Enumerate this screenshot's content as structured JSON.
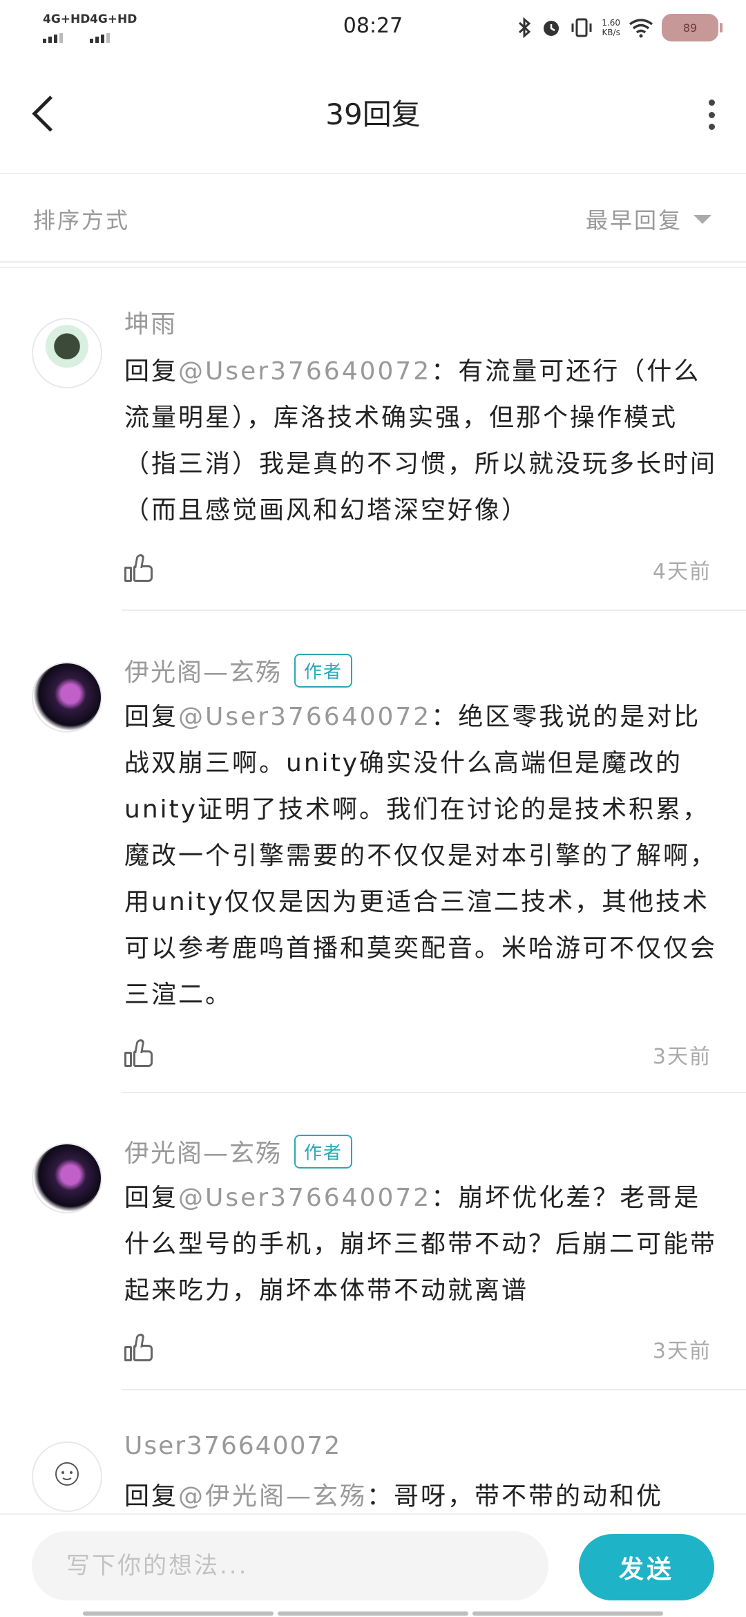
{
  "status_bar": {
    "signal_1": "4G+HD",
    "signal_2": "4G+HD",
    "time": "08:27",
    "net_speed": "1.60",
    "net_unit": "KB/s",
    "battery": "89"
  },
  "header": {
    "title": "39回复"
  },
  "sort": {
    "label": "排序方式",
    "value": "最早回复"
  },
  "comments": [
    {
      "author": "坤雨",
      "tag": "",
      "reply_prefix": "回复",
      "mention": "@User376640072",
      "text": "：有流量可还行（什么流量明星），库洛技术确实强，但那个操作模式（指三消）我是真的不习惯，所以就没玩多长时间（而且感觉画风和幻塔深空好像）",
      "time": "4天前"
    },
    {
      "author": "伊光阁—玄殇",
      "tag": "作者",
      "reply_prefix": "回复",
      "mention": "@User376640072",
      "text": "：绝区零我说的是对比战双崩三啊。unity确实没什么高端但是魔改的unity证明了技术啊。我们在讨论的是技术积累，魔改一个引擎需要的不仅仅是对本引擎的了解啊，用unity仅仅是因为更适合三渲二技术，其他技术可以参考鹿鸣首播和莫奕配音。米哈游可不仅仅会三渲二。",
      "time": "3天前"
    },
    {
      "author": "伊光阁—玄殇",
      "tag": "作者",
      "reply_prefix": "回复",
      "mention": "@User376640072",
      "text": "：崩坏优化差？老哥是什么型号的手机，崩坏三都带不动？后崩二可能带起来吃力，崩坏本体带不动就离谱",
      "time": "3天前"
    },
    {
      "author": "User376640072",
      "tag": "",
      "reply_prefix": "回复",
      "mention": "@伊光阁—玄殇",
      "text": "：哥呀，带不带的动和优",
      "time": ""
    }
  ],
  "composer": {
    "placeholder": "写下你的想法...",
    "send_label": "发送"
  },
  "colors": {
    "accent": "#1eb3c6",
    "tag": "#2aa8b8",
    "battery": "#c79898",
    "muted_text": "#999999"
  },
  "icons": [
    "back-icon",
    "more-icon",
    "sort-caret-icon",
    "like-icon",
    "bluetooth-icon",
    "alarm-icon",
    "vibrate-icon",
    "wifi-icon",
    "battery-icon"
  ]
}
